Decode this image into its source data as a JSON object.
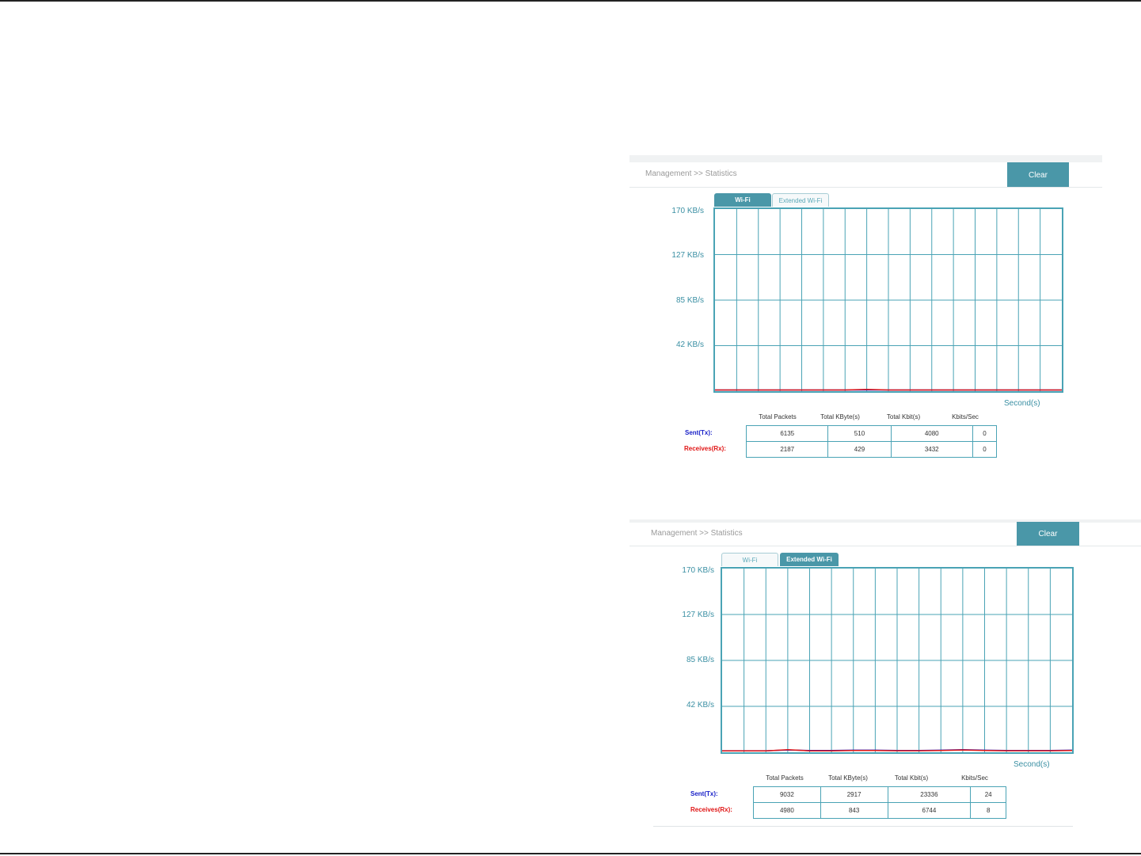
{
  "panels": [
    {
      "breadcrumb": "Management >> Statistics",
      "clear_label": "Clear",
      "tabs": [
        {
          "label": "Wi-Fi",
          "active": true
        },
        {
          "label": "Extended Wi-Fi",
          "active": false
        }
      ],
      "y_labels": [
        "170 KB/s",
        "127 KB/s",
        "85 KB/s",
        "42 KB/s"
      ],
      "x_unit": "Second(s)",
      "table": {
        "headers": [
          "Total Packets",
          "Total KByte(s)",
          "Total Kbit(s)",
          "Kbits/Sec"
        ],
        "rows": [
          {
            "label": "Sent(Tx):",
            "values": [
              "6135",
              "510",
              "4080",
              "0"
            ]
          },
          {
            "label": "Receives(Rx):",
            "values": [
              "2187",
              "429",
              "3432",
              "0"
            ]
          }
        ]
      }
    },
    {
      "breadcrumb": "Management >> Statistics",
      "clear_label": "Clear",
      "tabs": [
        {
          "label": "Wi-Fi",
          "active": false
        },
        {
          "label": "Extended Wi-Fi",
          "active": true
        }
      ],
      "y_labels": [
        "170 KB/s",
        "127 KB/s",
        "85 KB/s",
        "42 KB/s"
      ],
      "x_unit": "Second(s)",
      "table": {
        "headers": [
          "Total Packets",
          "Total KByte(s)",
          "Total Kbit(s)",
          "Kbits/Sec"
        ],
        "rows": [
          {
            "label": "Sent(Tx):",
            "values": [
              "9032",
              "2917",
              "23336",
              "24"
            ]
          },
          {
            "label": "Receives(Rx):",
            "values": [
              "4980",
              "843",
              "6744",
              "8"
            ]
          }
        ]
      }
    }
  ],
  "chart_data": [
    {
      "type": "line",
      "ylim": [
        0,
        170
      ],
      "y_ticks": [
        "170 KB/s",
        "127 KB/s",
        "85 KB/s",
        "42 KB/s"
      ],
      "xlabel": "Second(s)",
      "grid": true,
      "colors": {
        "tx": "#1a22c8",
        "rx": "#e01515",
        "grid": "#4aa3b5"
      },
      "series": [
        {
          "name": "Sent(Tx):",
          "values": [
            0,
            0,
            0,
            0,
            0,
            0,
            0,
            0,
            0,
            0,
            0,
            0,
            0,
            0,
            0,
            0,
            0
          ]
        },
        {
          "name": "Receives(Rx):",
          "values": [
            0,
            0,
            0,
            0,
            0,
            0,
            0,
            0.6,
            0,
            0,
            0,
            0,
            0,
            0,
            0,
            0,
            0
          ]
        }
      ]
    },
    {
      "type": "line",
      "ylim": [
        0,
        170
      ],
      "y_ticks": [
        "170 KB/s",
        "127 KB/s",
        "85 KB/s",
        "42 KB/s"
      ],
      "xlabel": "Second(s)",
      "grid": true,
      "colors": {
        "tx": "#1a22c8",
        "rx": "#e01515",
        "grid": "#4aa3b5"
      },
      "series": [
        {
          "name": "Sent(Tx):",
          "values": [
            0.3,
            0.3,
            0.3,
            1.0,
            0.5,
            0.5,
            0.8,
            0.8,
            0.5,
            0.5,
            0.8,
            1.3,
            0.8,
            0.5,
            0.5,
            0.5,
            0.8
          ]
        },
        {
          "name": "Receives(Rx):",
          "values": [
            0.2,
            0.2,
            0.2,
            1.3,
            0.2,
            0.2,
            0.5,
            0.5,
            0.3,
            0.3,
            0.5,
            1.0,
            0.6,
            0.3,
            0.3,
            0.3,
            0.6
          ]
        }
      ]
    }
  ]
}
